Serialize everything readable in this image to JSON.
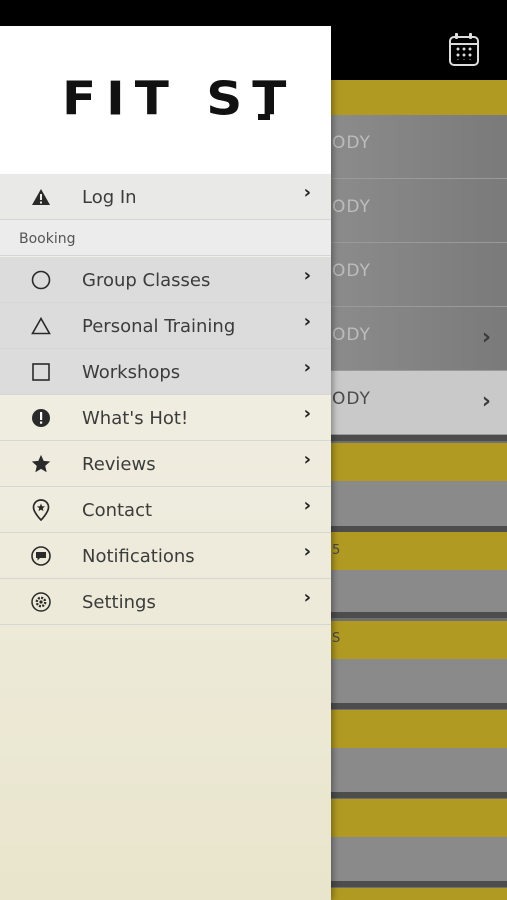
{
  "app": {
    "name": "FIT ST."
  },
  "background": {
    "list_rows": [
      {
        "text": "ODY"
      },
      {
        "text": "ODY"
      },
      {
        "text": "ODY"
      },
      {
        "text": "ODY"
      },
      {
        "text": "ODY"
      }
    ],
    "stripe_snippets": [
      "5",
      "S"
    ]
  },
  "drawer": {
    "logo_text": "FIT ST",
    "login": {
      "label": "Log In",
      "icon": "warning-icon"
    },
    "section_booking": "Booking",
    "items": [
      {
        "label": "Group Classes",
        "icon": "circle-outline-icon"
      },
      {
        "label": "Personal Training",
        "icon": "triangle-outline-icon"
      },
      {
        "label": "Workshops",
        "icon": "square-outline-icon"
      },
      {
        "label": "What's Hot!",
        "icon": "exclamation-circle-icon"
      },
      {
        "label": "Reviews",
        "icon": "star-icon"
      },
      {
        "label": "Contact",
        "icon": "location-pin-icon"
      },
      {
        "label": "Notifications",
        "icon": "chat-bubble-icon"
      },
      {
        "label": "Settings",
        "icon": "gear-icon"
      }
    ]
  },
  "colors": {
    "accent_yellow": "#b09a22",
    "drawer_bg": "#f3f2ec"
  }
}
